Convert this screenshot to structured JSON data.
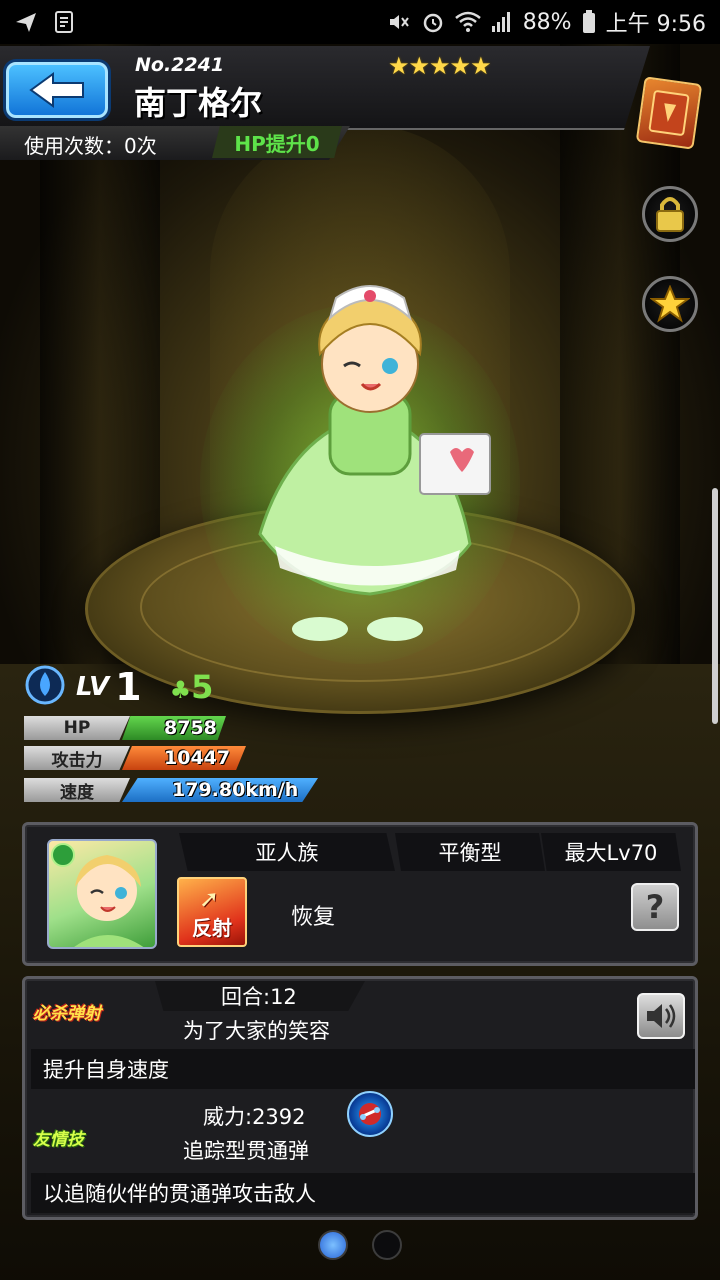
{
  "status_bar": {
    "battery": "88%",
    "time": "上午 9:56"
  },
  "monster": {
    "number": "No.2241",
    "name": "南丁格尔",
    "stars": "★★★★★",
    "uses_label": "使用次数：0次",
    "hp_boost": "HP提升0"
  },
  "stats": {
    "level_label": "LV",
    "level": "1",
    "luck": "5",
    "hp_label": "HP",
    "hp": "8758",
    "attack_label": "攻击力",
    "attack": "10447",
    "speed_label": "速度",
    "speed": "179.80km/h"
  },
  "info": {
    "race": "亚人族",
    "type": "平衡型",
    "max_level": "最大Lv70",
    "bounce_type": "反射",
    "ability": "恢复",
    "help": "?"
  },
  "strike_shot": {
    "tag": "必杀弹射",
    "turns": "回合:12",
    "name": "为了大家的笑容",
    "description": "提升自身速度"
  },
  "friendship": {
    "tag": "友情技",
    "power": "威力:2392",
    "name": "追踪型贯通弹",
    "description": "以追随伙伴的贯通弹攻击敌人"
  },
  "colors": {
    "hp_bar": "#3fb53a",
    "attack_bar": "#e2561e",
    "speed_bar": "#2d8ad8",
    "hp_boost_text": "#5ee34a",
    "accent_blue": "#1f8ef0"
  },
  "icons": {
    "back": "back-arrow-icon",
    "book": "monster-book-icon",
    "lock": "lock-icon",
    "favorite": "star-icon",
    "element": "water-element-icon",
    "luck": "clover-icon",
    "sound": "speaker-icon",
    "friendship": "friendship-shot-icon"
  }
}
